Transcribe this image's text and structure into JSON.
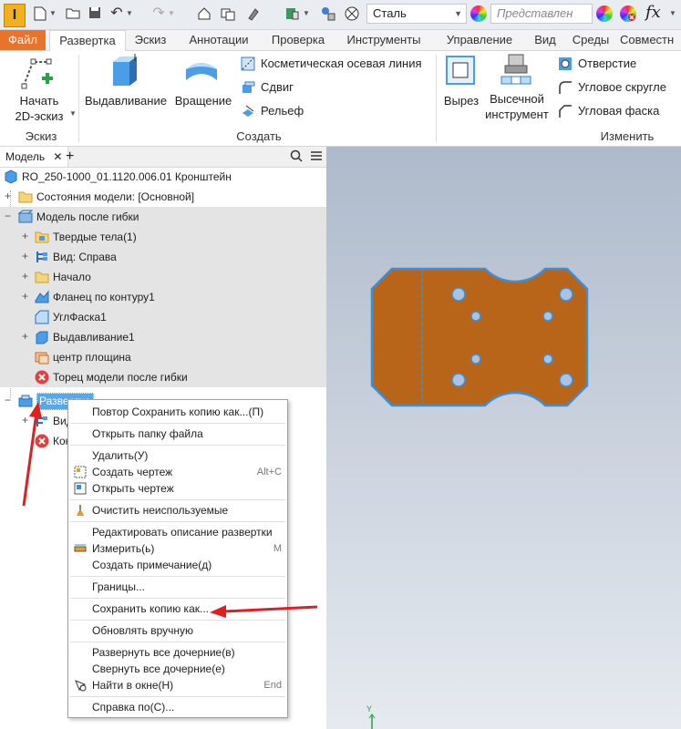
{
  "app": {
    "logo": "I"
  },
  "quick_access": {
    "material": "Сталь",
    "appearance": "Представлен",
    "icons": [
      "new-icon",
      "open-icon",
      "save-icon",
      "undo-icon",
      "redo-icon",
      "home-icon",
      "projects-icon",
      "update-icon",
      "select-icon",
      "material-icon",
      "appearance-icon",
      "fx-icon"
    ]
  },
  "tabs": [
    "Файл",
    "Развертка",
    "Эскиз",
    "Аннотации",
    "Проверка",
    "Инструменты",
    "Управление",
    "Вид",
    "Среды",
    "Совместн"
  ],
  "ribbon": {
    "sketch": {
      "start_line1": "Начать",
      "start_line2": "2D-эскиз",
      "group": "Эскиз"
    },
    "create": {
      "extrude": "Выдавливание",
      "revolve": "Вращение",
      "cosmetic": "Косметическая осевая линия",
      "shift": "Сдвиг",
      "emboss": "Рельеф",
      "group": "Создать"
    },
    "modify": {
      "cut": "Вырез",
      "punch_line1": "Высечной",
      "punch_line2": "инструмент",
      "hole": "Отверстие",
      "corner_round": "Угловое скругле",
      "corner_chamfer": "Угловая фаска",
      "group": "Изменить"
    }
  },
  "browser": {
    "tab_label": "Модель",
    "root": "RO_250-1000_01.1120.006.01 Кронштейн",
    "items": [
      {
        "label": "Состояния модели: [Основной]"
      },
      {
        "label": "Модель после гибки"
      },
      {
        "label": "Твердые тела(1)"
      },
      {
        "label": "Вид: Справа"
      },
      {
        "label": "Начало"
      },
      {
        "label": "Фланец по контуру1"
      },
      {
        "label": "УглФаска1"
      },
      {
        "label": "Выдавливание1"
      },
      {
        "label": "центр площина"
      },
      {
        "label": "Торец модели после гибки"
      },
      {
        "label": "Развертка"
      },
      {
        "label": "Вид"
      },
      {
        "label": "Кон"
      }
    ]
  },
  "context_menu": {
    "items": [
      {
        "label": "Повтор Сохранить копию как...(П)",
        "shortcut": ""
      },
      {
        "label": "Открыть папку файла",
        "shortcut": ""
      },
      {
        "label": "Удалить(У)",
        "shortcut": ""
      },
      {
        "label": "Создать чертеж",
        "shortcut": "Alt+C"
      },
      {
        "label": "Открыть чертеж",
        "shortcut": ""
      },
      {
        "label": "Очистить неиспользуемые",
        "shortcut": ""
      },
      {
        "label": "Редактировать описание развертки",
        "shortcut": ""
      },
      {
        "label": "Измерить(ь)",
        "shortcut": "M"
      },
      {
        "label": "Создать примечание(д)",
        "shortcut": ""
      },
      {
        "label": "Границы...",
        "shortcut": ""
      },
      {
        "label": "Сохранить копию как...",
        "shortcut": ""
      },
      {
        "label": "Обновлять вручную",
        "shortcut": ""
      },
      {
        "label": "Развернуть все дочерние(в)",
        "shortcut": ""
      },
      {
        "label": "Свернуть все дочерние(е)",
        "shortcut": ""
      },
      {
        "label": "Найти в окне(Н)",
        "shortcut": "End"
      },
      {
        "label": "Справка по(С)...",
        "shortcut": ""
      }
    ]
  },
  "viewport": {
    "axis_label": "Y"
  },
  "colors": {
    "accent": "#e8732b",
    "part_fill": "#b8651a",
    "part_edge": "#3a8fd8",
    "annotation_arrow": "#e02020",
    "selection": "#5aa7e6"
  }
}
